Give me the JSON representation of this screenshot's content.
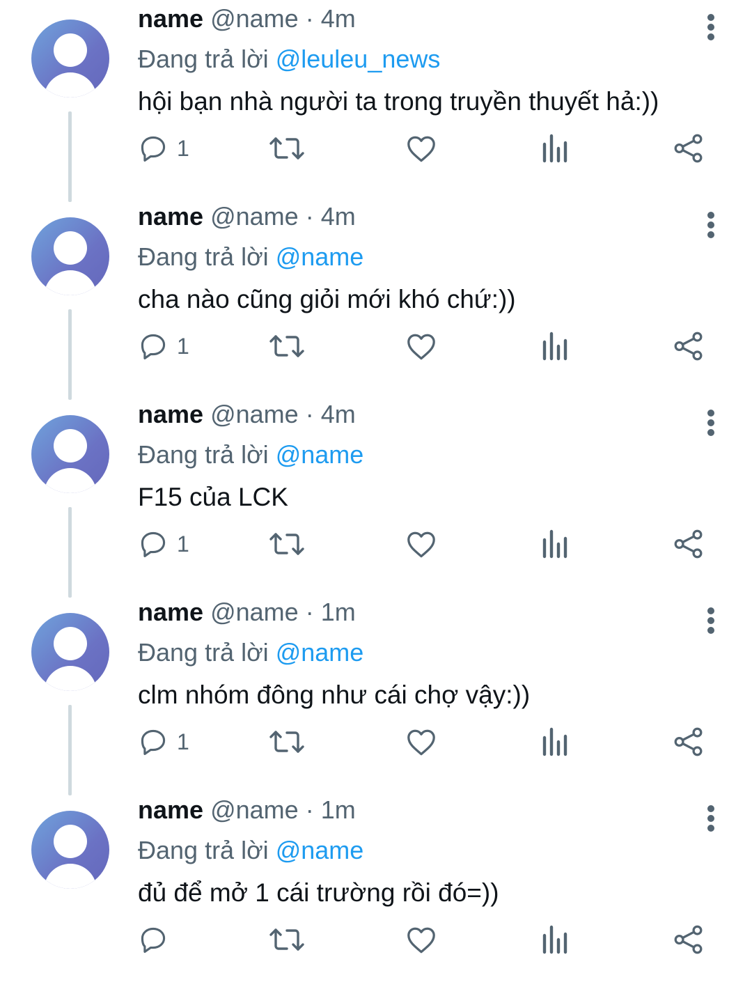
{
  "tweets": [
    {
      "display_name": "name",
      "handle": "@name",
      "separator": "·",
      "time": "4m",
      "replying_prefix": "Đang trả lời",
      "replying_to": "@leuleu_news",
      "text": "hội bạn nhà người ta trong truyền thuyết hả:))",
      "reply_count": "1"
    },
    {
      "display_name": "name",
      "handle": "@name",
      "separator": "·",
      "time": "4m",
      "replying_prefix": "Đang trả lời",
      "replying_to": "@name",
      "text": "cha nào cũng giỏi mới khó chứ:))",
      "reply_count": "1"
    },
    {
      "display_name": "name",
      "handle": "@name",
      "separator": "·",
      "time": "4m",
      "replying_prefix": "Đang trả lời",
      "replying_to": "@name",
      "text": "F15 của LCK",
      "reply_count": "1"
    },
    {
      "display_name": "name",
      "handle": "@name",
      "separator": "·",
      "time": "1m",
      "replying_prefix": "Đang trả lời",
      "replying_to": "@name",
      "text": "clm nhóm đông như cái chợ vậy:))",
      "reply_count": "1"
    },
    {
      "display_name": "name",
      "handle": "@name",
      "separator": "·",
      "time": "1m",
      "replying_prefix": "Đang trả lời",
      "replying_to": "@name",
      "text": "đủ để mở 1 cái trường rồi đó=))",
      "reply_count": ""
    }
  ],
  "icons": {
    "reply": "reply-icon",
    "retweet": "retweet-icon",
    "like": "heart-icon",
    "views": "views-icon",
    "share": "share-icon",
    "more": "more-vertical-icon"
  },
  "colors": {
    "text": "#0f1419",
    "secondary": "#536471",
    "accent": "#1d9bf0",
    "thread_line": "#cfd9de"
  }
}
